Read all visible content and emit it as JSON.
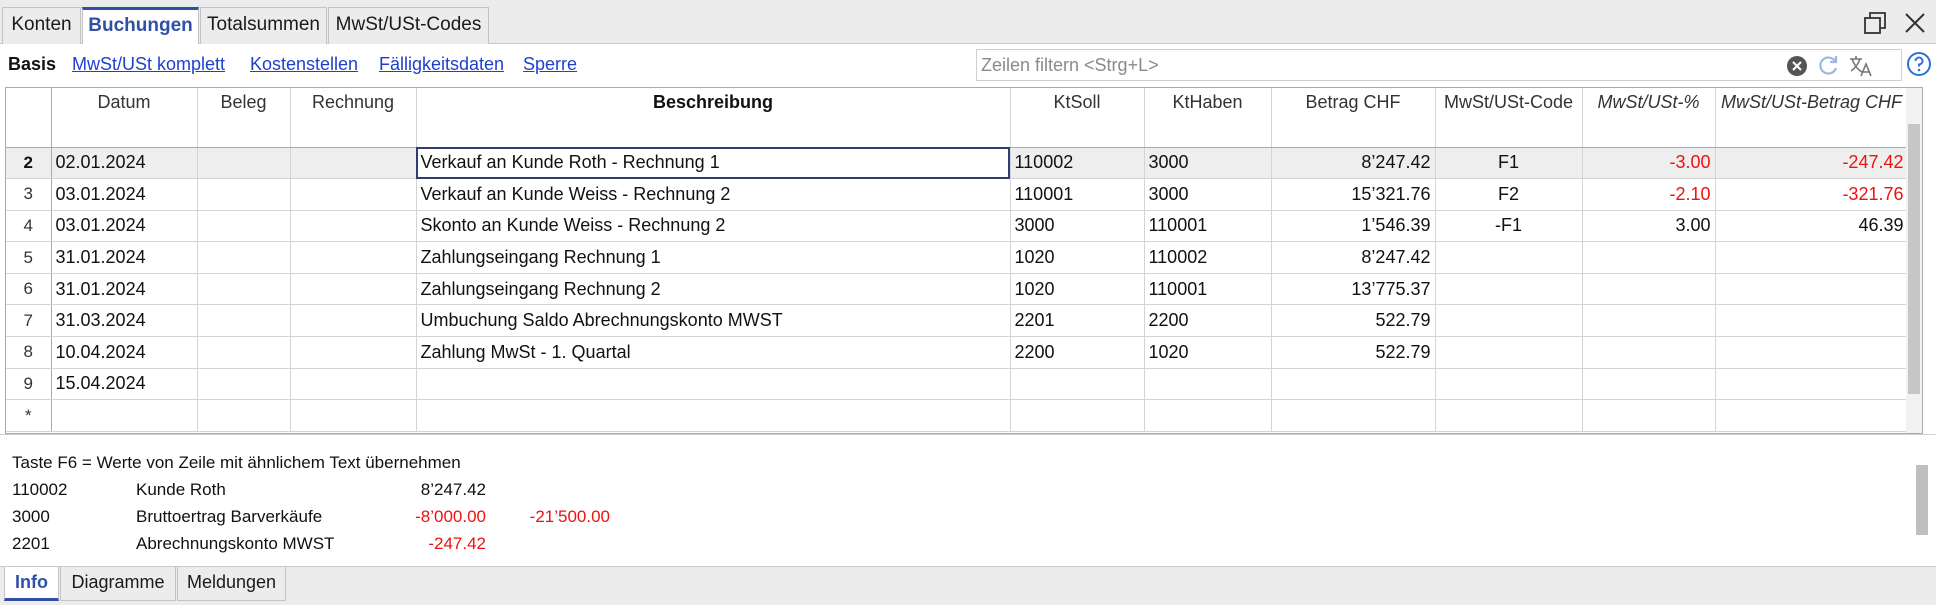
{
  "top_tabs": [
    "Konten",
    "Buchungen",
    "Totalsummen",
    "MwSt/USt-Codes"
  ],
  "active_top_tab": "Buchungen",
  "subbar": {
    "basis": "Basis",
    "links": [
      "MwSt/USt komplett",
      "Kostenstellen",
      "Fälligkeitsdaten",
      "Sperre"
    ],
    "filter_placeholder": "Zeilen filtern <Strg+L>"
  },
  "grid": {
    "columns": [
      "Datum",
      "Beleg",
      "Rechnung",
      "Beschreibung",
      "KtSoll",
      "KtHaben",
      "Betrag CHF",
      "MwSt/USt-Code",
      "MwSt/USt-%",
      "MwSt/USt-Betrag CHF"
    ],
    "rows": [
      {
        "num": "2",
        "datum": "02.01.2024",
        "beleg": "",
        "rechnung": "",
        "beschreibung": "Verkauf an Kunde Roth - Rechnung 1",
        "ktsoll": "110002",
        "kthaben": "3000",
        "betrag": "8’247.42",
        "code": "F1",
        "pct": "-3.00",
        "mwst": "-247.42"
      },
      {
        "num": "3",
        "datum": "03.01.2024",
        "beleg": "",
        "rechnung": "",
        "beschreibung": "Verkauf an Kunde Weiss - Rechnung 2",
        "ktsoll": "110001",
        "kthaben": "3000",
        "betrag": "15’321.76",
        "code": "F2",
        "pct": "-2.10",
        "mwst": "-321.76"
      },
      {
        "num": "4",
        "datum": "03.01.2024",
        "beleg": "",
        "rechnung": "",
        "beschreibung": "Skonto an Kunde Weiss - Rechnung 2",
        "ktsoll": "3000",
        "kthaben": "110001",
        "betrag": "1’546.39",
        "code": "-F1",
        "pct": "3.00",
        "mwst": "46.39"
      },
      {
        "num": "5",
        "datum": "31.01.2024",
        "beleg": "",
        "rechnung": "",
        "beschreibung": "Zahlungseingang Rechnung 1",
        "ktsoll": "1020",
        "kthaben": "110002",
        "betrag": "8’247.42",
        "code": "",
        "pct": "",
        "mwst": ""
      },
      {
        "num": "6",
        "datum": "31.01.2024",
        "beleg": "",
        "rechnung": "",
        "beschreibung": "Zahlungseingang Rechnung 2",
        "ktsoll": "1020",
        "kthaben": "110001",
        "betrag": "13’775.37",
        "code": "",
        "pct": "",
        "mwst": ""
      },
      {
        "num": "7",
        "datum": "31.03.2024",
        "beleg": "",
        "rechnung": "",
        "beschreibung": "Umbuchung Saldo Abrechnungskonto MWST",
        "ktsoll": "2201",
        "kthaben": "2200",
        "betrag": "522.79",
        "code": "",
        "pct": "",
        "mwst": ""
      },
      {
        "num": "8",
        "datum": "10.04.2024",
        "beleg": "",
        "rechnung": "",
        "beschreibung": "Zahlung MwSt - 1. Quartal",
        "ktsoll": "2200",
        "kthaben": "1020",
        "betrag": "522.79",
        "code": "",
        "pct": "",
        "mwst": ""
      },
      {
        "num": "9",
        "datum": "15.04.2024",
        "beleg": "",
        "rechnung": "",
        "beschreibung": "",
        "ktsoll": "",
        "kthaben": "",
        "betrag": "",
        "code": "",
        "pct": "",
        "mwst": ""
      },
      {
        "num": "*",
        "datum": "",
        "beleg": "",
        "rechnung": "",
        "beschreibung": "",
        "ktsoll": "",
        "kthaben": "",
        "betrag": "",
        "code": "",
        "pct": "",
        "mwst": ""
      }
    ]
  },
  "info": {
    "hint": "Taste F6 = Werte von Zeile mit ähnlichem Text übernehmen",
    "lines": [
      {
        "account": "110002",
        "name": "Kunde Roth",
        "value1": "8’247.42",
        "value2": ""
      },
      {
        "account": "3000",
        "name": "Bruttoertrag Barverkäufe",
        "value1": "-8’000.00",
        "value2": "-21’500.00"
      },
      {
        "account": "2201",
        "name": "Abrechnungskonto MWST",
        "value1": "-247.42",
        "value2": ""
      }
    ]
  },
  "bottom_tabs": [
    "Info",
    "Diagramme",
    "Meldungen"
  ],
  "active_bottom_tab": "Info",
  "colors": {
    "accent": "#2f51a5",
    "link": "#1f3fd0",
    "negative": "#ee1111"
  }
}
